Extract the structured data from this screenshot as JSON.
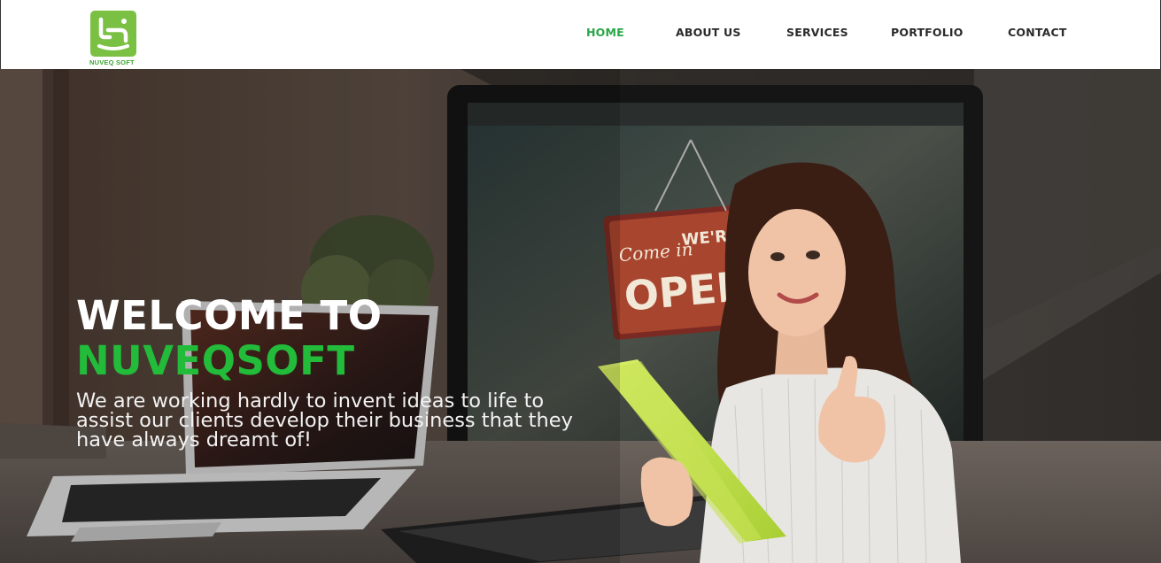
{
  "brand": {
    "name": "NUVEQ SOFT",
    "color": "#7ac143",
    "text_color": "#3fa535"
  },
  "nav": {
    "items": [
      {
        "label": "HOME",
        "active": true
      },
      {
        "label": "ABOUT US",
        "active": false
      },
      {
        "label": "SERVICES",
        "active": false
      },
      {
        "label": "PORTFOLIO",
        "active": false
      },
      {
        "label": "CONTACT",
        "active": false
      }
    ],
    "active_color": "#28a745"
  },
  "hero": {
    "title_line1": "WELCOME TO",
    "title_line2": "NUVEQSOFT",
    "subtitle": "We are working hardly to invent ideas to life to assist our clients develop their business that they have always dreamt of!",
    "sign_text_1": "Come in",
    "sign_text_2": "WE'RE",
    "sign_text_3": "OPEN",
    "accent_color": "#22bb3a"
  }
}
